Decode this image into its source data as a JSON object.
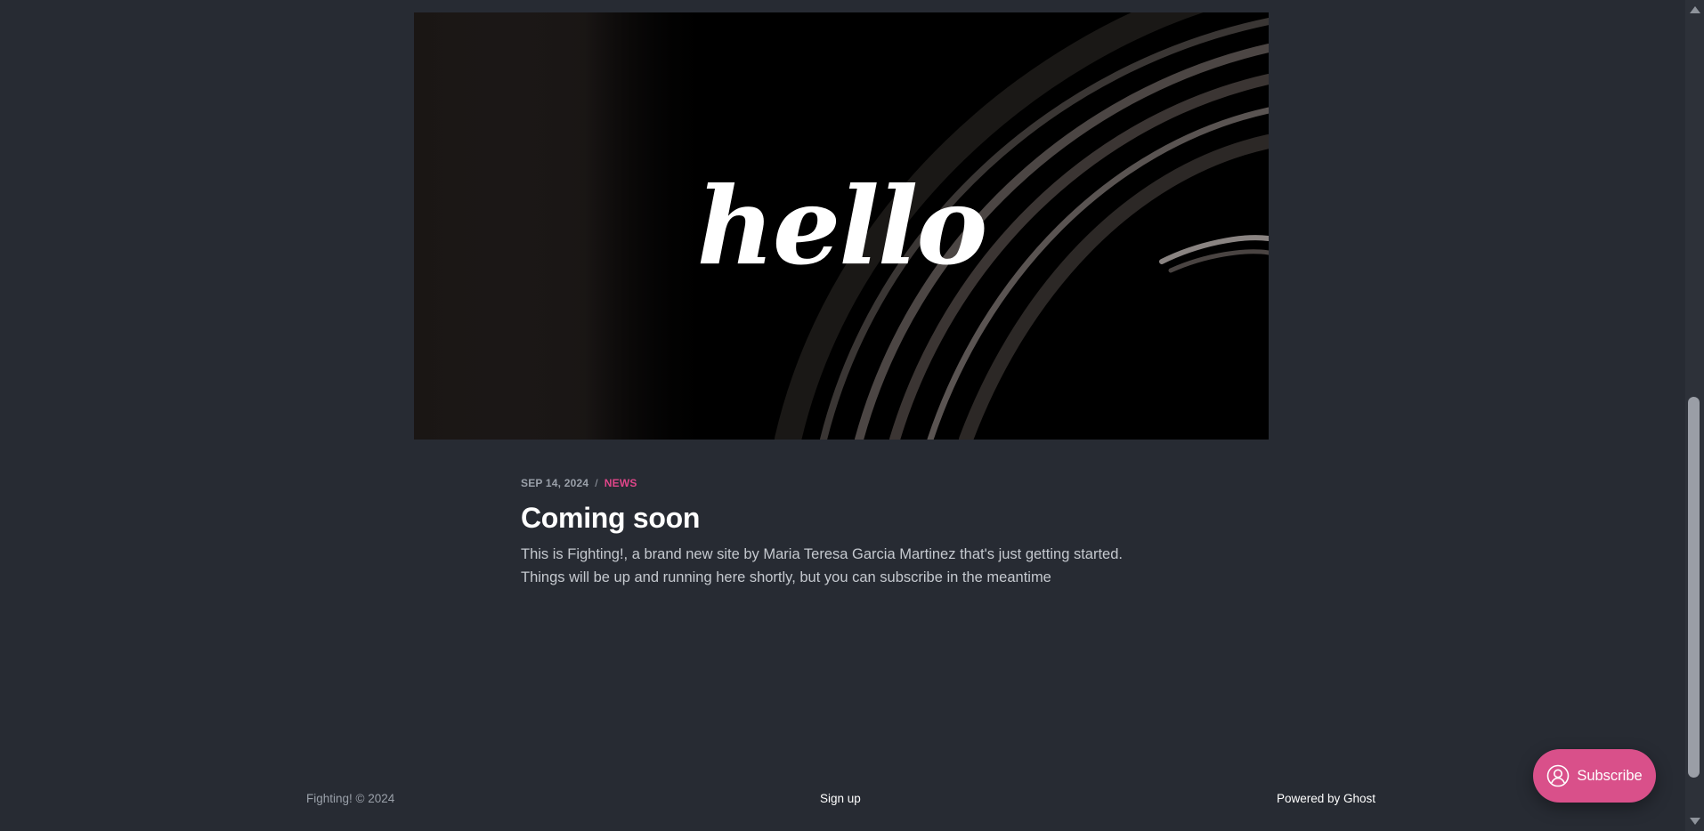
{
  "hero": {
    "image_icon": "hello-feature-image",
    "image_text": "hello"
  },
  "post": {
    "date": "SEP 14, 2024",
    "separator": "/",
    "tag": "NEWS",
    "title": "Coming soon",
    "excerpt": "This is Fighting!, a brand new site by Maria Teresa Garcia Martinez that's just getting started. Things will be up and running here shortly, but you can subscribe in the meantime"
  },
  "footer": {
    "copyright": "Fighting! © 2024",
    "signup_label": "Sign up",
    "powered_by": "Powered by Ghost"
  },
  "portal": {
    "subscribe_label": "Subscribe",
    "icon": "user-circle-icon"
  },
  "colors": {
    "background": "#272b33",
    "accent": "#d9508a",
    "tag": "#e0468a"
  }
}
